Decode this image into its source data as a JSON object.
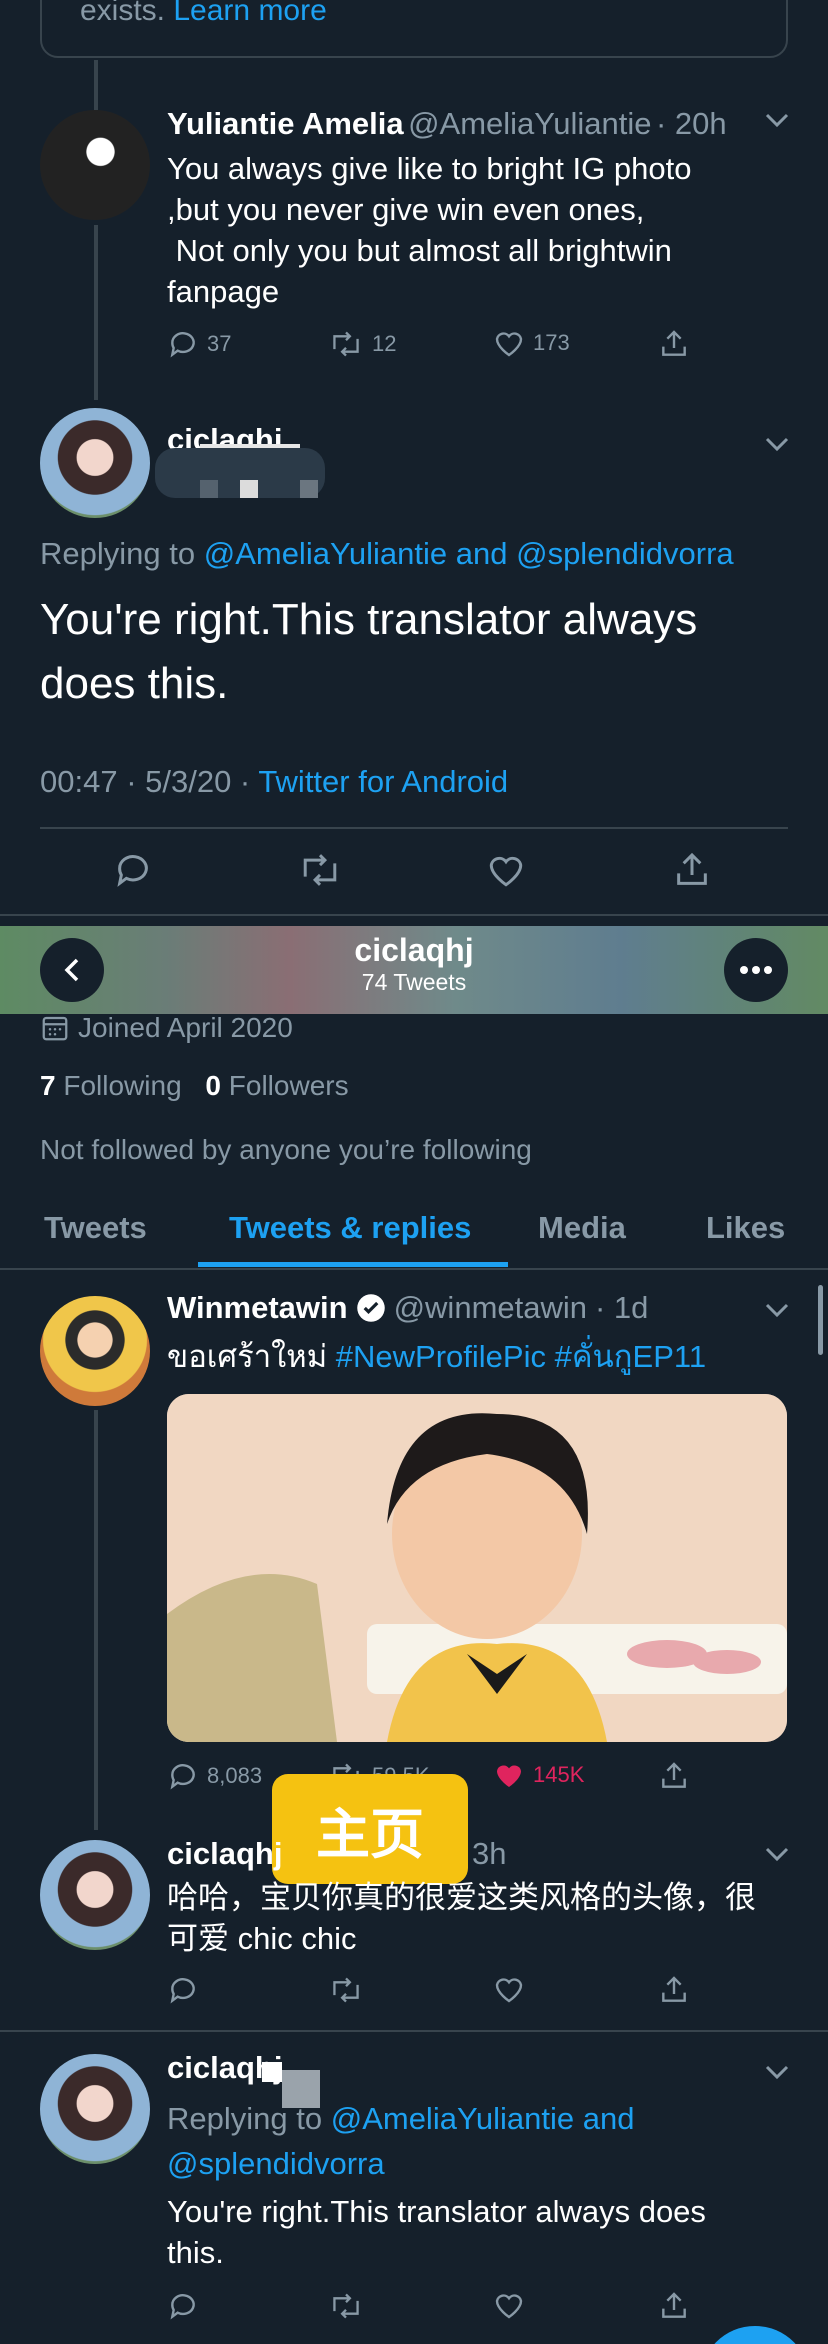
{
  "top_notice": {
    "text_plain": "exists.",
    "link": "Learn more"
  },
  "tweet1": {
    "name": "Yuliantie Amelia",
    "handle": "@AmeliaYuliantie",
    "time": "· 20h",
    "lines": [
      "You always give like to bright IG photo",
      ",but you never give win even ones,",
      " Not only you but almost all brightwin",
      "fanpage"
    ],
    "replies": "37",
    "retweets": "12",
    "likes": "173"
  },
  "tweet2": {
    "name": "ciclaqhj",
    "replying_prefix": "Replying to",
    "replying_to": "@AmeliaYuliantie and @splendidvorra",
    "lines": [
      "You're right.This translator always",
      "does this."
    ],
    "time": "00:47 · 5/3/20 ·",
    "source": "Twitter for Android"
  },
  "profile_header": {
    "name": "ciclaqhj",
    "tweets_count": "74 Tweets"
  },
  "profile": {
    "joined": "Joined April 2020",
    "following_count": "7",
    "following_label": "Following",
    "followers_count": "0",
    "followers_label": "Followers",
    "not_followed": "Not followed by anyone you’re following"
  },
  "tabs": [
    "Tweets",
    "Tweets & replies",
    "Media",
    "Likes"
  ],
  "tweet3": {
    "name": "Winmetawin",
    "handle": "@winmetawin",
    "time": "· 1d",
    "text_thai": "ขอเศร้าใหม่",
    "hashtags": "#NewProfilePic #คั่นกูEP11",
    "replies": "8,083",
    "retweets": "59.5K",
    "likes": "145K"
  },
  "home_badge": "主页",
  "tweet4": {
    "name": "ciclaqhj",
    "time": "3h",
    "lines": [
      "哈哈，宝贝你真的很爱这类风格的头像，很",
      "可爱 chic chic"
    ]
  },
  "tweet5": {
    "name": "ciclaqhj",
    "replying_prefix": "Replying to",
    "replying_line1": "@AmeliaYuliantie and",
    "replying_line2": "@splendidvorra",
    "lines": [
      "You're right.This translator always does",
      "this."
    ]
  },
  "colors": {
    "bg": "#15202b",
    "accent": "#1da1f2",
    "muted": "#8899a6",
    "like": "#e0245e",
    "badge": "#f5c211"
  }
}
